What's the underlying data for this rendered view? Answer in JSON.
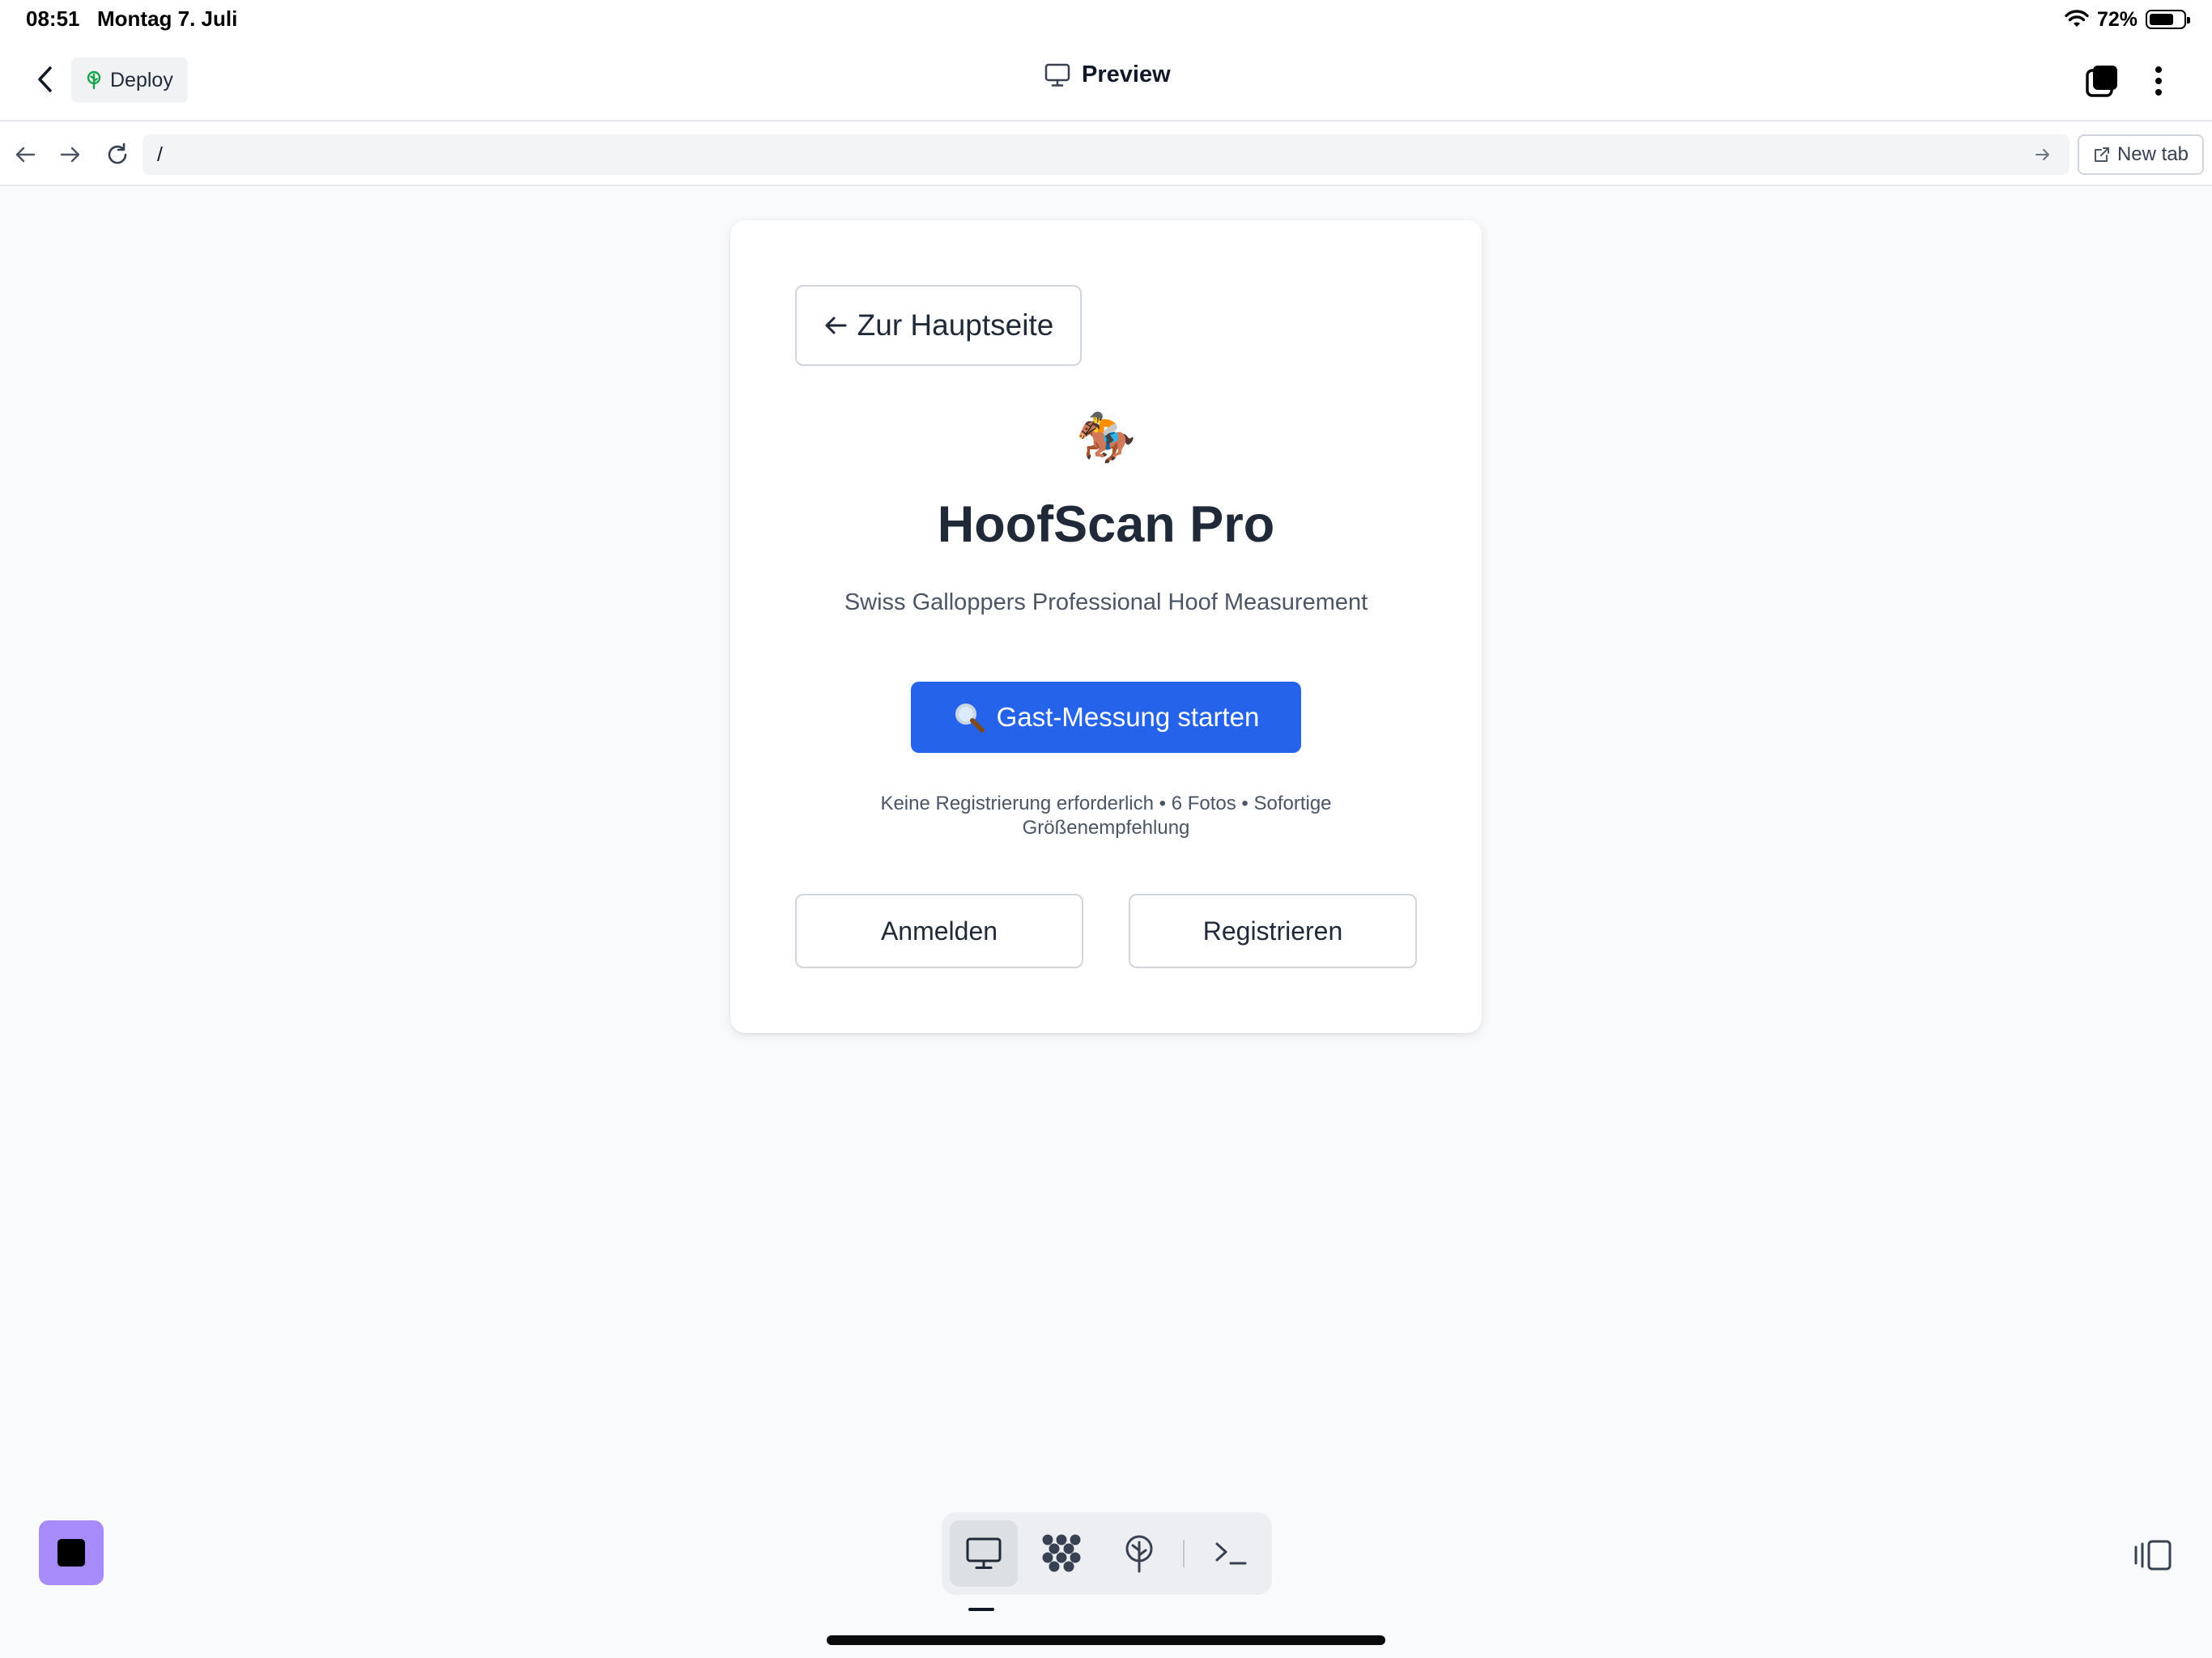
{
  "status": {
    "time": "08:51",
    "date": "Montag 7. Juli",
    "battery": "72%",
    "battery_level": 0.72
  },
  "toolbar": {
    "deploy_label": "Deploy",
    "preview_label": "Preview"
  },
  "browser": {
    "url": "/",
    "new_tab_label": "New tab"
  },
  "card": {
    "back_label": "Zur Hauptseite",
    "logo_emoji": "🏇",
    "title": "HoofScan Pro",
    "subtitle": "Swiss Galloppers Professional Hoof Measurement",
    "guest_button_label": "Gast-Messung starten",
    "note": "Keine Registrierung erforderlich • 6 Fotos • Sofortige Größenempfehlung",
    "login_label": "Anmelden",
    "register_label": "Registrieren"
  },
  "colors": {
    "primary": "#2563eb",
    "stop_button": "#a78bfa"
  },
  "icons": {
    "back": "chevron-left-icon",
    "deploy": "tree-icon",
    "preview": "monitor-icon",
    "tabs": "tabs-icon",
    "more": "more-vertical-icon",
    "nav_back": "arrow-left-icon",
    "nav_forward": "arrow-right-icon",
    "reload": "reload-icon",
    "go": "arrow-right-icon",
    "new_tab": "external-link-icon",
    "search": "magnifier-icon",
    "tools": [
      "monitor-icon",
      "dots-grid-icon",
      "deploy-tree-icon",
      "terminal-icon"
    ],
    "layout": "sidebar-layout-icon"
  }
}
